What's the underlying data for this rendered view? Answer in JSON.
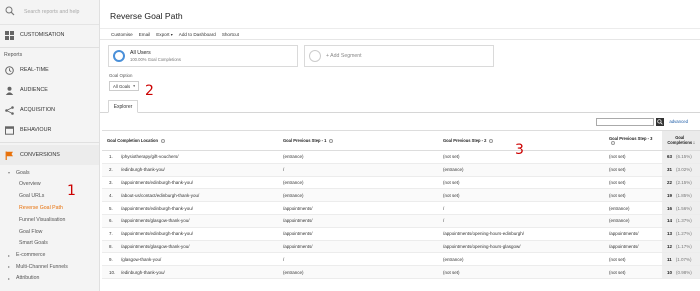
{
  "sidebar": {
    "search_placeholder": "Search reports and help",
    "customisation": "CUSTOMISATION",
    "reports_heading": "Reports",
    "nav": [
      {
        "label": "REAL-TIME"
      },
      {
        "label": "AUDIENCE"
      },
      {
        "label": "ACQUISITION"
      },
      {
        "label": "BEHAVIOUR"
      }
    ],
    "conversions": "CONVERSIONS",
    "goals": "Goals",
    "goal_items": [
      "Overview",
      "Goal URLs",
      "Reverse Goal Path",
      "Funnel Visualisation",
      "Goal Flow",
      "Smart Goals"
    ],
    "sub_sections": [
      "E-commerce",
      "Multi-Channel Funnels",
      "Attribution"
    ]
  },
  "main": {
    "title": "Reverse Goal Path",
    "toolbar": {
      "customise": "Customise",
      "email": "Email",
      "export": "Export",
      "export_caret": "▾",
      "add_to_dashboard": "Add to Dashboard",
      "shortcut": "Shortcut"
    },
    "segment": {
      "name": "All Users",
      "sub": "100.00% Goal Completions"
    },
    "add_segment": "+ Add Segment",
    "goal_option": {
      "label": "Goal Option",
      "value": "All Goals"
    },
    "tab": "Explorer",
    "advanced": "advanced",
    "columns": {
      "location": "Goal Completion Location",
      "step1": "Goal Previous Step - 1",
      "step2": "Goal Previous Step - 2",
      "step3": "Goal Previous Step - 3",
      "completions": "Goal Completions"
    },
    "rows": [
      {
        "n": "1.",
        "loc": "/physiotherapy/gift-vouchers/",
        "s1": "(entrance)",
        "s2": "(not set)",
        "s3": "(not set)",
        "c": "63",
        "p": "(6.15%)"
      },
      {
        "n": "2.",
        "loc": "/edinburgh-thank-you/",
        "s1": "/",
        "s2": "(entrance)",
        "s3": "(not set)",
        "c": "31",
        "p": "(3.02%)"
      },
      {
        "n": "3.",
        "loc": "/appointments/edinburgh-thank-you/",
        "s1": "(entrance)",
        "s2": "(not set)",
        "s3": "(not set)",
        "c": "22",
        "p": "(2.15%)"
      },
      {
        "n": "4.",
        "loc": "/about-us/contact/edinburgh-thank-you/",
        "s1": "(entrance)",
        "s2": "(not set)",
        "s3": "(not set)",
        "c": "19",
        "p": "(1.85%)"
      },
      {
        "n": "5.",
        "loc": "/appointments/edinburgh-thank-you/",
        "s1": "/appointments/",
        "s2": "/",
        "s3": "(entrance)",
        "c": "16",
        "p": "(1.56%)"
      },
      {
        "n": "6.",
        "loc": "/appointments/glasgow-thank-you/",
        "s1": "/appointments/",
        "s2": "/",
        "s3": "(entrance)",
        "c": "14",
        "p": "(1.37%)"
      },
      {
        "n": "7.",
        "loc": "/appointments/edinburgh-thank-you/",
        "s1": "/appointments/",
        "s2": "/appointments/opening-hours-edinburgh/",
        "s3": "/appointments/",
        "c": "13",
        "p": "(1.27%)"
      },
      {
        "n": "8.",
        "loc": "/appointments/glasgow-thank-you/",
        "s1": "/appointments/",
        "s2": "/appointments/opening-hours-glasgow/",
        "s3": "/appointments/",
        "c": "12",
        "p": "(1.17%)"
      },
      {
        "n": "9.",
        "loc": "/glasgow-thank-you/",
        "s1": "/",
        "s2": "(entrance)",
        "s3": "(not set)",
        "c": "11",
        "p": "(1.07%)"
      },
      {
        "n": "10.",
        "loc": "/edinburgh-thank-you/",
        "s1": "(entrance)",
        "s2": "(not set)",
        "s3": "(not set)",
        "c": "10",
        "p": "(0.98%)"
      }
    ]
  },
  "annotations": [
    "1",
    "2",
    "3"
  ],
  "colors": {
    "active": "#e8710a",
    "segment": "#4a90d9",
    "annotation": "#cc0000",
    "link": "#1a5aa6"
  }
}
